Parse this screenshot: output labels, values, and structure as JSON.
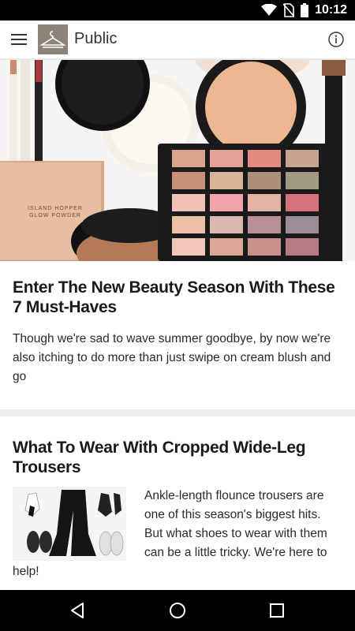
{
  "status_bar": {
    "time": "10:12",
    "icons": [
      "wifi-icon",
      "no-sim-icon",
      "battery-icon"
    ]
  },
  "app_bar": {
    "title": "Public",
    "menu_icon": "hamburger-menu-icon",
    "logo_icon": "hanger-icon",
    "info_icon": "info-icon"
  },
  "articles": [
    {
      "headline": "Enter The New Beauty Season With These 7 Must-Haves",
      "excerpt": "Though we're sad to wave summer goodbye, by now we're also itching to do more than just swipe on cream blush and go",
      "hero_text": "ISLAND HOPPER\nGLOW POWDER"
    },
    {
      "headline": "What To Wear With Cropped Wide-Leg Trousers",
      "excerpt_lines": [
        "Ankle-length flounce trousers are",
        "one of this season's biggest hits.",
        "But what shoes to wear with them",
        "can be a little tricky. We're here to",
        "help!"
      ]
    }
  ],
  "nav_bar": {
    "icons": [
      "back-icon",
      "home-icon",
      "recents-icon"
    ]
  },
  "colors": {
    "status_bar": "#000000",
    "logo_bg": "#8c8479",
    "divider": "#ececec",
    "nav_bar": "#000000"
  }
}
